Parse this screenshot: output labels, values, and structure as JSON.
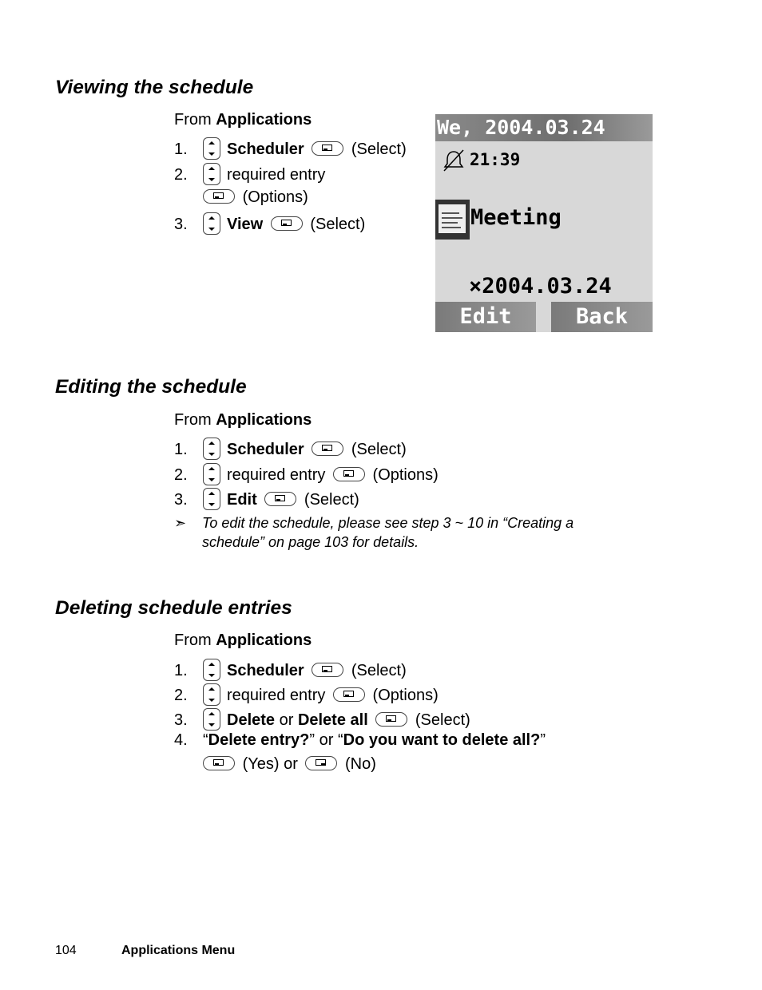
{
  "sections": [
    {
      "title": "Viewing the schedule",
      "from_prefix": "From ",
      "from_target": "Applications",
      "steps": [
        {
          "num": "1.",
          "bold": "Scheduler",
          "suffix": "(Select)"
        },
        {
          "num": "2.",
          "text": "required entry",
          "suffix": "(Options)"
        },
        {
          "num": "3.",
          "bold": "View",
          "suffix": "(Select)"
        }
      ]
    },
    {
      "title": "Editing the schedule",
      "from_prefix": "From ",
      "from_target": "Applications",
      "steps": [
        {
          "num": "1.",
          "bold": "Scheduler",
          "suffix": "(Select)"
        },
        {
          "num": "2.",
          "text": "required entry",
          "suffix": "(Options)"
        },
        {
          "num": "3.",
          "bold": "Edit",
          "suffix": "(Select)"
        }
      ],
      "note": {
        "arrow": "➣",
        "line1": "To edit the schedule, please see step 3 ~ 10 in “Creating a",
        "line2": "schedule” on page 103 for details."
      }
    },
    {
      "title": "Deleting schedule entries",
      "from_prefix": "From ",
      "from_target": "Applications",
      "steps": [
        {
          "num": "1.",
          "bold": "Scheduler",
          "suffix": "(Select)"
        },
        {
          "num": "2.",
          "text": "required entry",
          "suffix": "(Options)"
        },
        {
          "num": "3.",
          "bold": "Delete",
          "mid": " or ",
          "bold2": "Delete all",
          "suffix": "(Select)"
        },
        {
          "num": "4.",
          "q1": "Delete entry?",
          "mid": " or ",
          "q2": "Do you want to delete all?",
          "yes": "(Yes) or",
          "no": "(No)"
        }
      ]
    }
  ],
  "phone_screen": {
    "title": "We, 2004.03.24",
    "alarm_icon": "alarm-off-icon",
    "time": "21:39",
    "memo_icon": "memo-icon",
    "subject": "Meeting",
    "date": "×2004.03.24",
    "left_soft": "Edit",
    "right_soft": "Back"
  },
  "icons": {
    "nav_key": "nav-updown-key-icon",
    "left_soft_key": "left-soft-key-icon",
    "right_soft_key": "right-soft-key-icon"
  },
  "footer": {
    "page_number": "104",
    "chapter": "Applications Menu"
  }
}
